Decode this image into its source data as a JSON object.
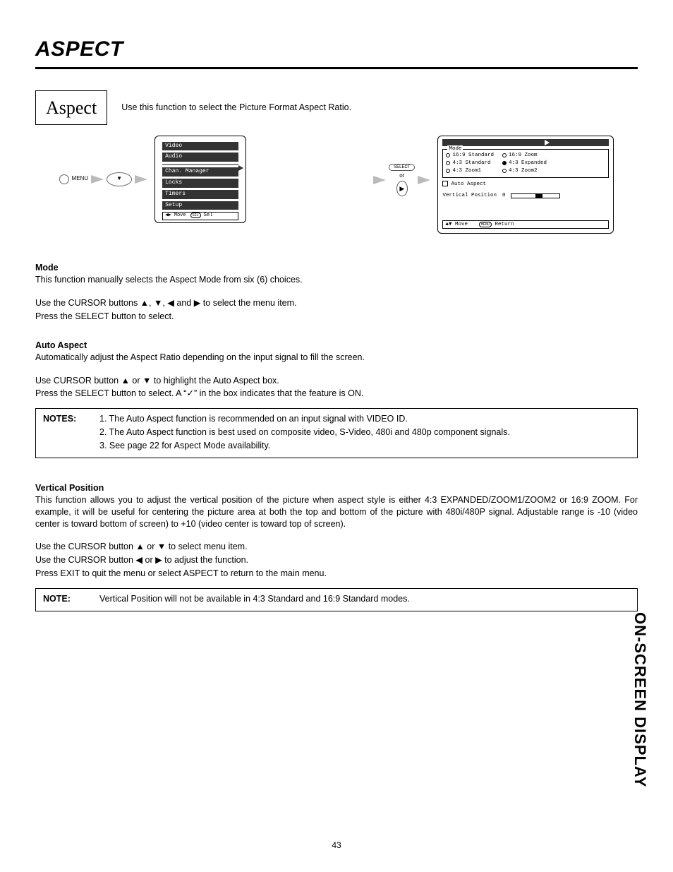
{
  "page": {
    "title": "ASPECT",
    "aspect_box": "Aspect",
    "intro": "Use this function to select the Picture Format Aspect Ratio.",
    "side_tab": "ON-SCREEN DISPLAY",
    "number": "43"
  },
  "diagram": {
    "menu_label": "MENU",
    "osd_list": {
      "items": [
        "Video",
        "Audio",
        "",
        "Chan. Manager",
        "Locks",
        "Timers",
        "Setup"
      ],
      "footer_move": "Move",
      "footer_sel": "Sel",
      "footer_sel_btn": "SEL"
    },
    "select": {
      "btn": "SELECT",
      "or": "or",
      "tri": "▶"
    },
    "osd_detail": {
      "mode_label": "Mode",
      "col1": [
        "16:9 Standard",
        "4:3 Standard",
        "4:3 Zoom1"
      ],
      "col2": [
        "16:9 Zoom",
        "4:3 Expanded",
        "4:3 Zoom2"
      ],
      "auto_aspect": "Auto Aspect",
      "vp_label": "Vertical Position",
      "vp_value": "0",
      "footer_move": "Move",
      "footer_return": "Return",
      "footer_menu": "MENU"
    },
    "cursor_glyph": "▼"
  },
  "sections": {
    "mode": {
      "heading": "Mode",
      "line1": "This function manually selects the Aspect Mode from six (6) choices.",
      "line2": "Use the CURSOR buttons ▲, ▼, ◀ and ▶ to select the menu item.",
      "line3": "Press the SELECT button to select."
    },
    "auto": {
      "heading": "Auto Aspect",
      "line1": "Automatically adjust the Aspect Ratio depending on the input signal to fill the screen.",
      "line2": "Use CURSOR button ▲ or ▼ to highlight the Auto Aspect box.",
      "line3": "Press the SELECT button to select. A “✓” in the box indicates that the feature is ON."
    },
    "notes1": {
      "label": "NOTES:",
      "n1": "1. The Auto Aspect function is recommended on an input signal with VIDEO ID.",
      "n2": "2. The Auto Aspect function is best used on composite video, S-Video, 480i and 480p component signals.",
      "n3": "3. See page 22 for Aspect Mode availability."
    },
    "vp": {
      "heading": "Vertical Position",
      "para": "This function allows you to adjust the vertical position of the picture when aspect style is either 4:3 EXPANDED/ZOOM1/ZOOM2 or 16:9 ZOOM.  For example, it will be useful for centering the picture area at both the top and bottom of the picture with 480i/480P signal. Adjustable range is -10 (video center is toward bottom of screen) to +10 (video center is toward top of screen).",
      "line2": "Use the CURSOR button ▲ or ▼ to select menu item.",
      "line3": "Use the CURSOR button ◀ or ▶ to adjust the function.",
      "line4": "Press EXIT to quit the menu or select ASPECT to return to the main menu."
    },
    "notes2": {
      "label": "NOTE:",
      "n1": "Vertical Position will not be available in 4:3 Standard and 16:9 Standard modes."
    }
  }
}
